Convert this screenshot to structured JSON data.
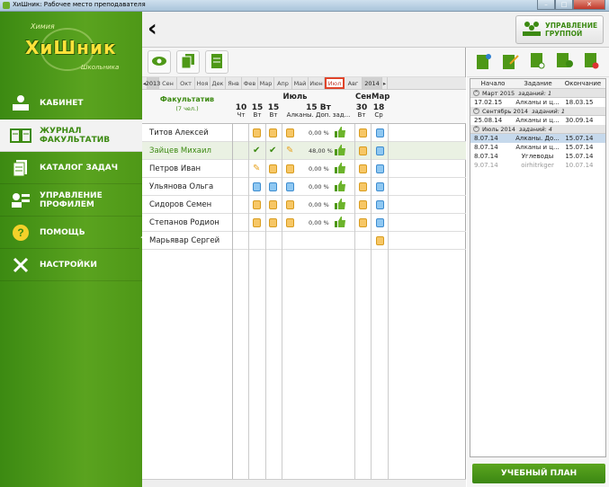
{
  "window": {
    "title": "ХиШник: Рабочее место преподавателя",
    "min": "–",
    "max": "□",
    "close": "✕"
  },
  "logo": {
    "top": "Химия",
    "main": "ХиШник",
    "bottom": "Школьника"
  },
  "nav": {
    "items": [
      {
        "label": "КАБИНЕТ"
      },
      {
        "label": "ЖУРНАЛ ФАКУЛЬТАТИВ"
      },
      {
        "label": "КАТАЛОГ ЗАДАЧ"
      },
      {
        "label": "УПРАВЛЕНИЕ ПРОФИЛЕМ"
      },
      {
        "label": "ПОМОЩЬ"
      },
      {
        "label": "НАСТРОЙКИ"
      }
    ]
  },
  "header": {
    "back": "‹",
    "group_btn": "УПРАВЛЕНИЕ ГРУППОЙ"
  },
  "months": [
    "2013",
    "Сен",
    "Окт",
    "Ноя",
    "Дек",
    "Янв",
    "Фев",
    "Мар",
    "Апр",
    "Май",
    "Июн",
    "Июл",
    "Авг",
    "2014"
  ],
  "months_selected": "Июл",
  "grid": {
    "group_title": "Факультатив",
    "group_count": "(7 чел.)",
    "month_july": "Июль",
    "month_sep": "Сен",
    "month_mar": "Мар",
    "cols": [
      {
        "day": "10",
        "dow": "Чт"
      },
      {
        "day": "15",
        "dow": "Вт"
      },
      {
        "day": "15",
        "dow": "Вт"
      },
      {
        "day": "15 Вт",
        "dow": "Алканы. Доп. зад..."
      },
      {
        "day": "30",
        "dow": "Вт"
      },
      {
        "day": "18",
        "dow": "Ср"
      }
    ],
    "rows": [
      {
        "name": "Титов Алексей",
        "pct": ""
      },
      {
        "name": "Зайцев Михаил",
        "pct": "48,00 %"
      },
      {
        "name": "Петров Иван",
        "pct": "0,00 %"
      },
      {
        "name": "Ульянова Ольга",
        "pct": "0,00 %"
      },
      {
        "name": "Сидоров Семен",
        "pct": "0,00 %"
      },
      {
        "name": "Степанов Родион",
        "pct": "0,00 %"
      },
      {
        "name": "Марьявар Сергей",
        "pct": ""
      }
    ],
    "row0_pct": "0,00 %"
  },
  "right": {
    "cols": [
      "Начало",
      "Задание",
      "Окончание"
    ],
    "groups": [
      {
        "label": "Март 2015",
        "count": "заданий: 1",
        "items": [
          [
            "17.02.15",
            "Алканы и ц...",
            "18.03.15"
          ]
        ]
      },
      {
        "label": "Сентябрь 2014",
        "count": "заданий: 1",
        "items": [
          [
            "25.08.14",
            "Алканы и ц...",
            "30.09.14"
          ]
        ]
      },
      {
        "label": "Июль 2014",
        "count": "заданий: 4",
        "items": [
          [
            "8.07.14",
            "Алканы. До...",
            "15.07.14"
          ],
          [
            "8.07.14",
            "Алканы и ц...",
            "15.07.14"
          ],
          [
            "8.07.14",
            "Углеводы",
            "15.07.14"
          ],
          [
            "9.07.14",
            "oirhitrkger",
            "10.07.14"
          ]
        ]
      }
    ],
    "plan_btn": "УЧЕБНЫЙ ПЛАН"
  },
  "colors": {
    "brand_green": "#4e9817",
    "accent_orange": "#f7c766",
    "accent_blue": "#8fc8f2",
    "selected_month": "#e0442a"
  }
}
